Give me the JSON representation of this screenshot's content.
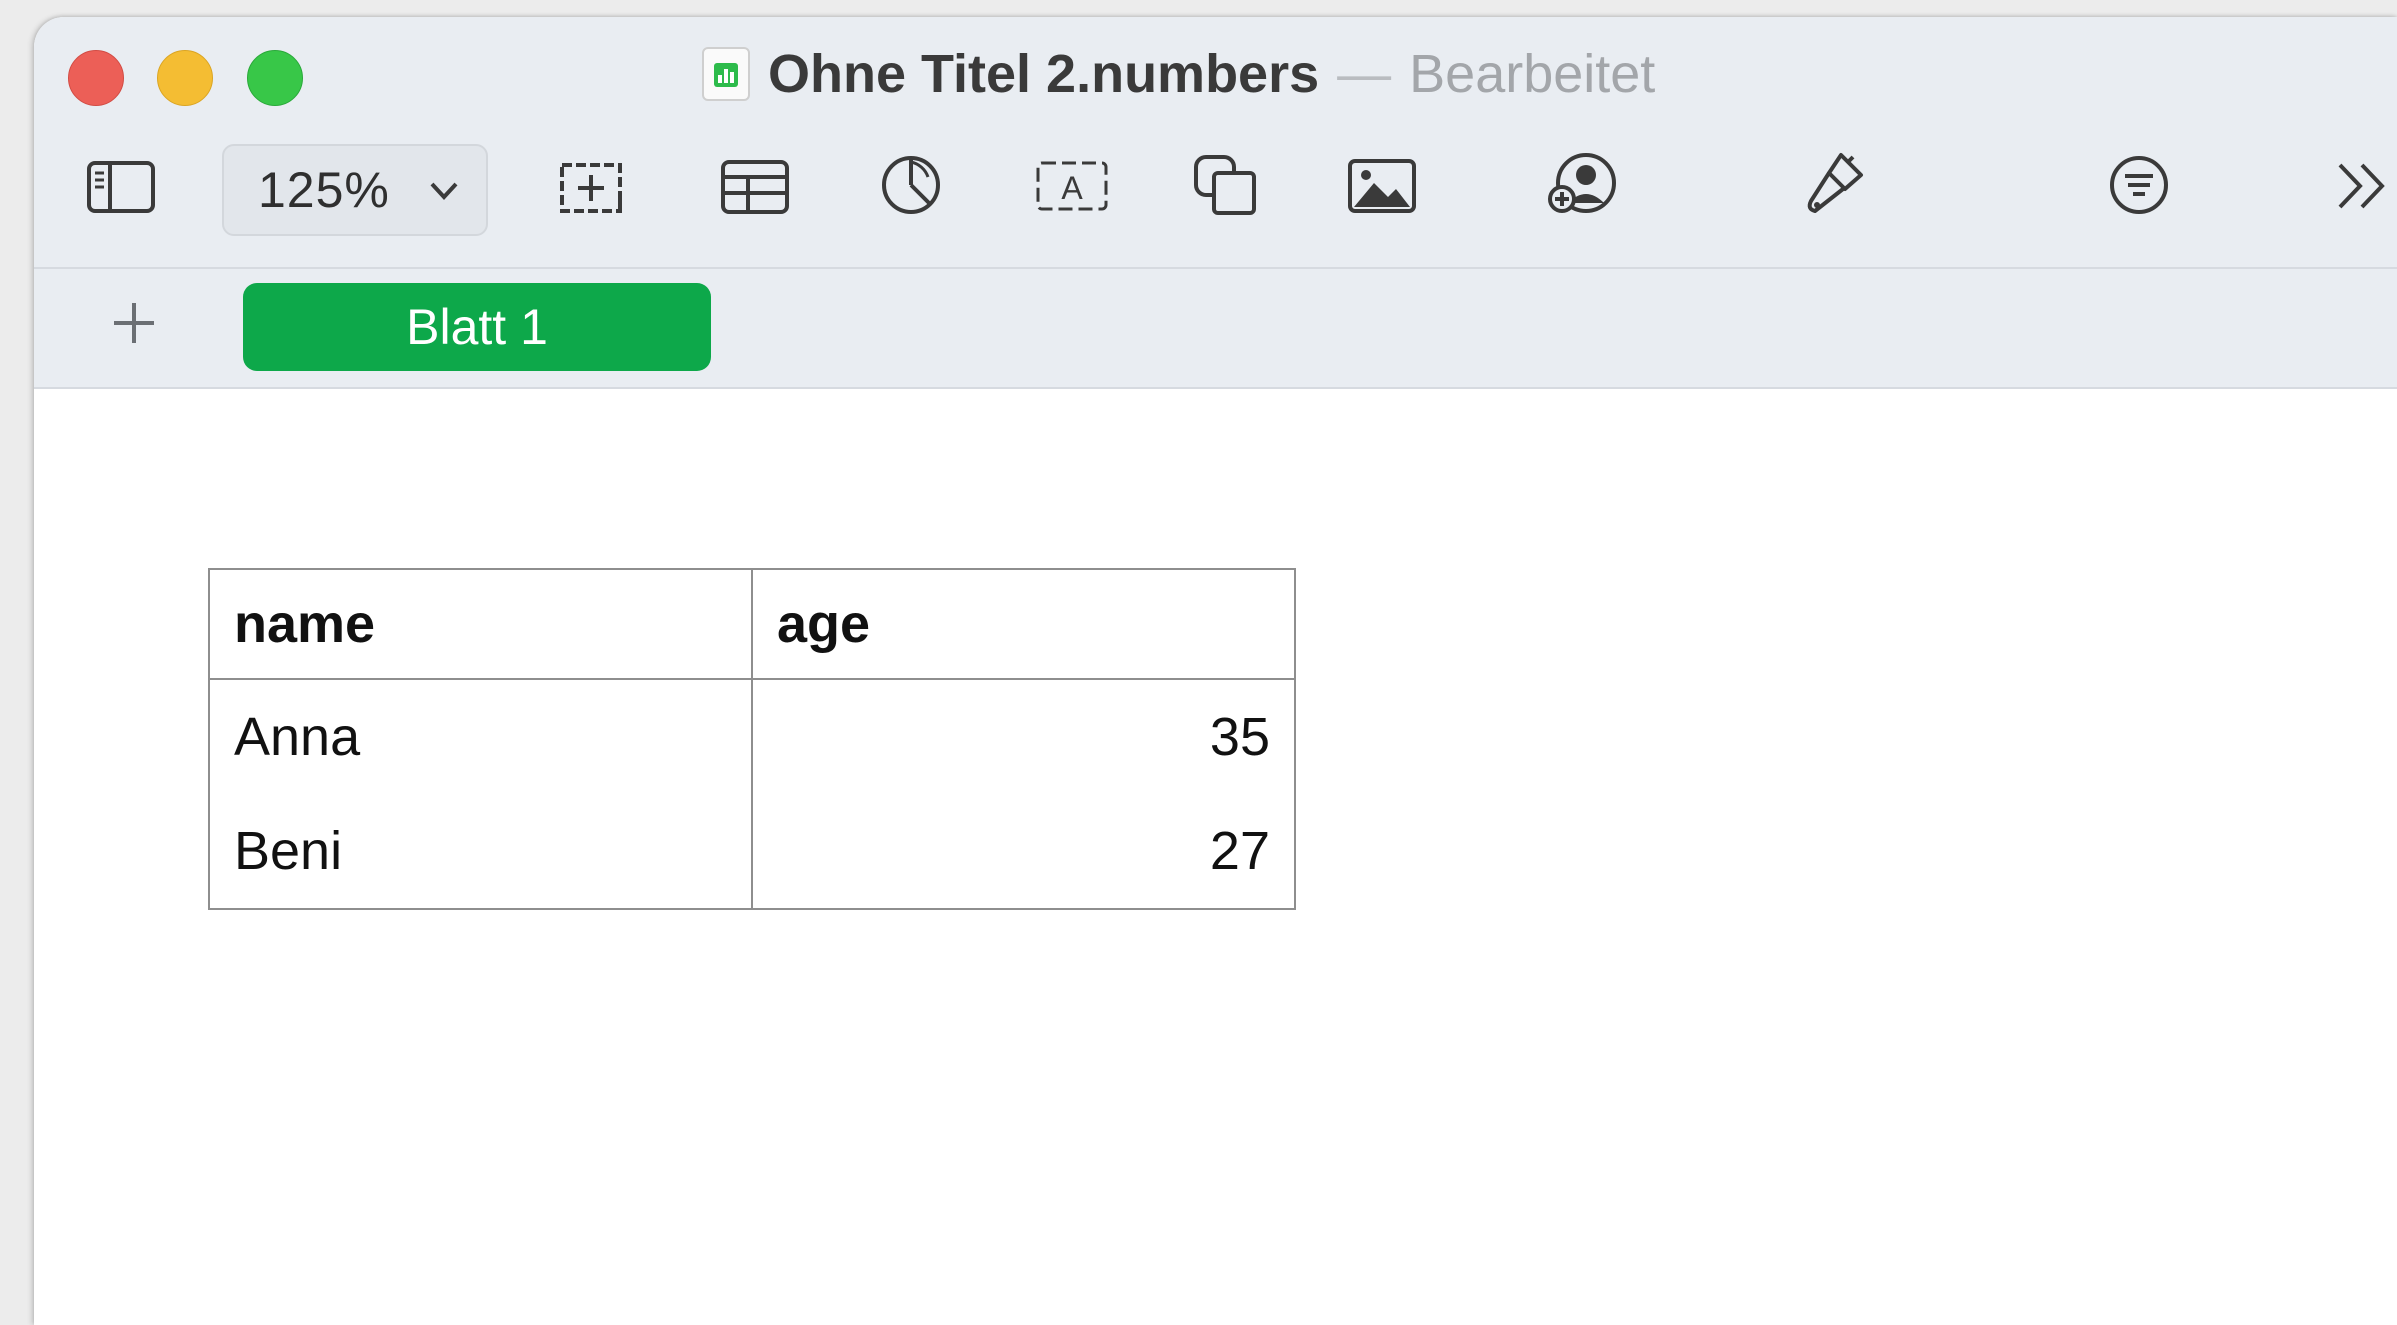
{
  "window": {
    "title": "Ohne Titel 2.numbers",
    "separator": "—",
    "status": "Bearbeitet"
  },
  "toolbar": {
    "zoom": "125%",
    "icons": [
      "sidebar-icon",
      "insert-icon",
      "table-icon",
      "chart-icon",
      "text-icon",
      "shape-icon",
      "media-icon",
      "collaborate-icon",
      "format-icon",
      "organize-icon",
      "more-icon"
    ]
  },
  "sheets": {
    "tabs": [
      {
        "label": "Blatt 1",
        "active": true
      }
    ]
  },
  "table": {
    "headers": [
      "name",
      "age"
    ],
    "rows": [
      [
        "Anna",
        "35"
      ],
      [
        "Beni",
        "27"
      ]
    ]
  },
  "colors": {
    "active_tab": "#0da84a",
    "close": "#ec5f57",
    "minimize": "#f4bd33",
    "maximize": "#38c748"
  }
}
